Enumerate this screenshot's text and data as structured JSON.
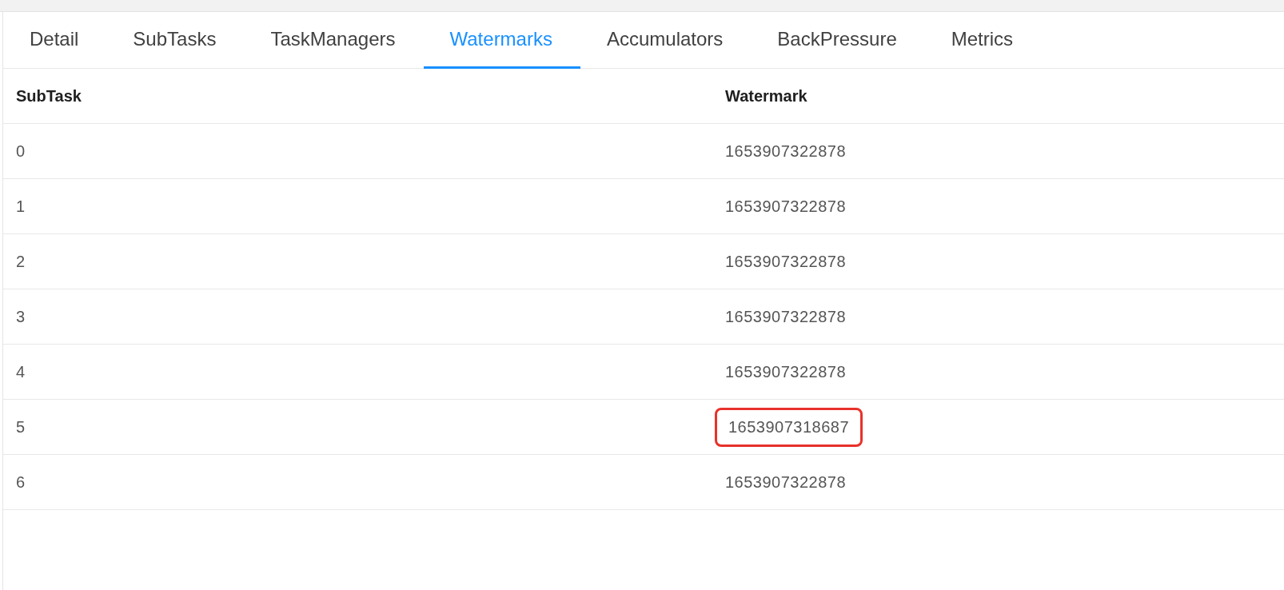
{
  "tabs": [
    {
      "label": "Detail",
      "selected": false
    },
    {
      "label": "SubTasks",
      "selected": false
    },
    {
      "label": "TaskManagers",
      "selected": false
    },
    {
      "label": "Watermarks",
      "selected": true
    },
    {
      "label": "Accumulators",
      "selected": false
    },
    {
      "label": "BackPressure",
      "selected": false
    },
    {
      "label": "Metrics",
      "selected": false
    }
  ],
  "table": {
    "columns": [
      "SubTask",
      "Watermark"
    ],
    "rows": [
      {
        "subtask": "0",
        "watermark": "1653907322878",
        "highlighted": false
      },
      {
        "subtask": "1",
        "watermark": "1653907322878",
        "highlighted": false
      },
      {
        "subtask": "2",
        "watermark": "1653907322878",
        "highlighted": false
      },
      {
        "subtask": "3",
        "watermark": "1653907322878",
        "highlighted": false
      },
      {
        "subtask": "4",
        "watermark": "1653907322878",
        "highlighted": false
      },
      {
        "subtask": "5",
        "watermark": "1653907318687",
        "highlighted": true
      },
      {
        "subtask": "6",
        "watermark": "1653907322878",
        "highlighted": false
      }
    ]
  }
}
